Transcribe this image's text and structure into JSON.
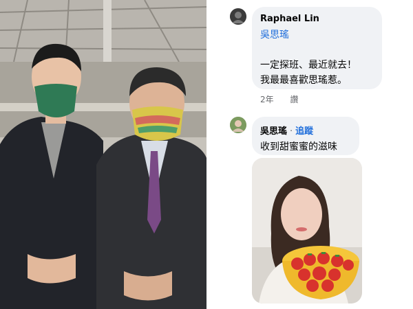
{
  "photo": {
    "description_icon": "two-men-wearing-masks-photo"
  },
  "comment1": {
    "author": "Raphael Lin",
    "mention": "吳思瑤",
    "line1": "一定探班、最近就去！",
    "line2": "我最最喜歡思瑤惹。",
    "time": "2年",
    "action": "讚"
  },
  "reply": {
    "author": "吳思瑤",
    "separator": "·",
    "follow": "追蹤",
    "text": "收到甜蜜蜜的滋味",
    "image_icon": "woman-holding-strawberries-photo"
  },
  "colors": {
    "bubble": "#f0f2f5",
    "link": "#216fdb",
    "muted": "#65676b"
  }
}
